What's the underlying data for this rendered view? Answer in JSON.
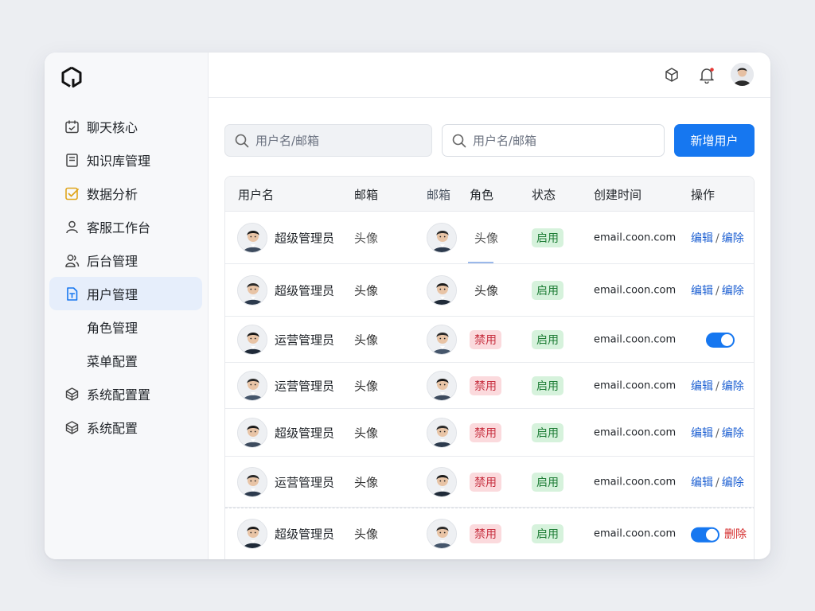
{
  "sidebar": {
    "items": [
      {
        "label": "聊天核心",
        "icon": "calendar-icon"
      },
      {
        "label": "知识库管理",
        "icon": "notebook-icon"
      },
      {
        "label": "数据分析",
        "icon": "checkbox-icon"
      },
      {
        "label": "客服工作台",
        "icon": "user-icon"
      },
      {
        "label": "后台管理",
        "icon": "users-icon"
      },
      {
        "label": "用户管理",
        "icon": "file-icon",
        "active": true
      },
      {
        "label": "角色管理",
        "sub": true
      },
      {
        "label": "菜单配置",
        "sub": true
      },
      {
        "label": "系统配置置",
        "icon": "cube-icon"
      },
      {
        "label": "系统配置",
        "icon": "cube-icon"
      }
    ]
  },
  "search": {
    "placeholder1": "用户名/邮箱",
    "placeholder2": "用户名/邮箱"
  },
  "toolbar": {
    "add_label": "新增用户"
  },
  "colors": {
    "accent": "#1677f0",
    "tag_red": "#fbdadd",
    "tag_green": "#d6f2dc"
  },
  "table": {
    "headers": [
      "用户名",
      "邮箱",
      "邮箱",
      "角色",
      "状态",
      "创建时间",
      "操作"
    ],
    "rows": [
      {
        "name": "超级管理员",
        "col2": "头像",
        "role": "头像",
        "role_tag": false,
        "status": "启用",
        "email": "email.coon.com",
        "op_type": "text",
        "edit": "编辑",
        "sep": "/",
        "del": "编除",
        "del_red": false
      },
      {
        "name": "超级管理员",
        "col2": "头像",
        "role": "头像",
        "role_tag": false,
        "status": "启用",
        "email": "email.coon.com",
        "op_type": "text",
        "edit": "编辑",
        "sep": "/",
        "del": "编除",
        "del_red": false
      },
      {
        "name": "运营管理员",
        "col2": "头像",
        "role": "禁用",
        "role_tag": true,
        "status": "启用",
        "email": "email.coon.com",
        "op_type": "toggle"
      },
      {
        "name": "运营管理员",
        "col2": "头像",
        "role": "禁用",
        "role_tag": true,
        "status": "启用",
        "email": "email.coon.com",
        "op_type": "text",
        "edit": "编辑",
        "sep": "/",
        "del": "编除",
        "del_red": false
      },
      {
        "name": "超级管理员",
        "col2": "头像",
        "role": "禁用",
        "role_tag": true,
        "status": "启用",
        "email": "email.coon.com",
        "op_type": "text",
        "edit": "编辑",
        "sep": "/",
        "del": "编除",
        "del_red": false
      },
      {
        "name": "运营管理员",
        "col2": "头像",
        "role": "禁用",
        "role_tag": true,
        "status": "启用",
        "email": "email.coon.com",
        "op_type": "text",
        "edit": "编辑",
        "sep": "/",
        "del": "编除",
        "del_red": false
      },
      {
        "name": "超级管理员",
        "col2": "头像",
        "role": "禁用",
        "role_tag": true,
        "status": "启用",
        "email": "email.coon.com",
        "op_type": "toggle_del",
        "del": "删除",
        "del_red": true
      }
    ]
  }
}
